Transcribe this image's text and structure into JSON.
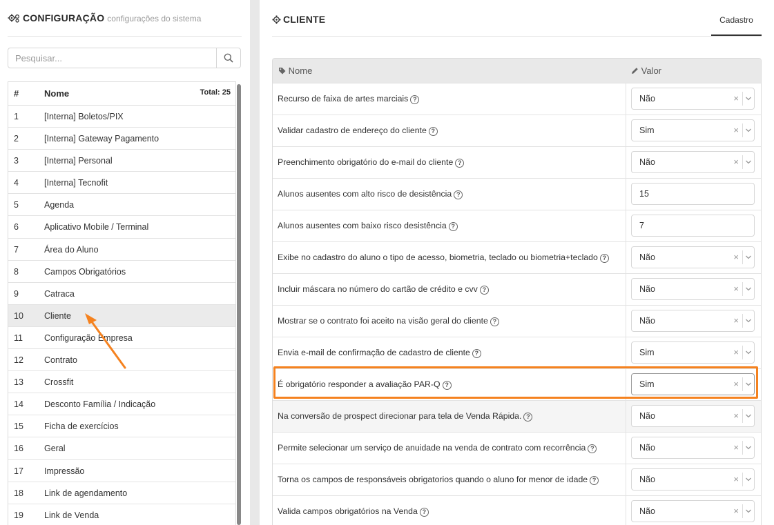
{
  "left_panel": {
    "title": "CONFIGURAÇÃO",
    "subtitle": "configurações do sistema",
    "search_placeholder": "Pesquisar...",
    "list_header": {
      "col_num": "#",
      "col_name": "Nome",
      "total": "Total: 25"
    },
    "items": [
      {
        "num": "1",
        "name": "[Interna] Boletos/PIX"
      },
      {
        "num": "2",
        "name": "[Interna] Gateway Pagamento"
      },
      {
        "num": "3",
        "name": "[Interna] Personal"
      },
      {
        "num": "4",
        "name": "[Interna] Tecnofit"
      },
      {
        "num": "5",
        "name": "Agenda"
      },
      {
        "num": "6",
        "name": "Aplicativo Mobile / Terminal"
      },
      {
        "num": "7",
        "name": "Área do Aluno"
      },
      {
        "num": "8",
        "name": "Campos Obrigatórios"
      },
      {
        "num": "9",
        "name": "Catraca"
      },
      {
        "num": "10",
        "name": "Cliente",
        "selected": true
      },
      {
        "num": "11",
        "name": "Configuração Empresa"
      },
      {
        "num": "12",
        "name": "Contrato"
      },
      {
        "num": "13",
        "name": "Crossfit"
      },
      {
        "num": "14",
        "name": "Desconto Família / Indicação"
      },
      {
        "num": "15",
        "name": "Ficha de exercícios"
      },
      {
        "num": "16",
        "name": "Geral"
      },
      {
        "num": "17",
        "name": "Impressão"
      },
      {
        "num": "18",
        "name": "Link de agendamento"
      },
      {
        "num": "19",
        "name": "Link de Venda"
      }
    ]
  },
  "right_panel": {
    "title": "CLIENTE",
    "tab": "Cadastro",
    "table_header": {
      "col_name": "Nome",
      "col_value": "Valor"
    },
    "rows": [
      {
        "label": "Recurso de faixa de artes marciais",
        "type": "select",
        "value": "Não"
      },
      {
        "label": "Validar cadastro de endereço do cliente",
        "type": "select",
        "value": "Sim"
      },
      {
        "label": "Preenchimento obrigatório do e-mail do cliente",
        "type": "select",
        "value": "Não"
      },
      {
        "label": "Alunos ausentes com alto risco de desistência",
        "type": "number",
        "value": "15"
      },
      {
        "label": "Alunos ausentes com baixo risco desistência",
        "type": "number",
        "value": "7"
      },
      {
        "label": "Exibe no cadastro do aluno o tipo de acesso, biometria, teclado ou biometria+teclado",
        "type": "select",
        "value": "Não"
      },
      {
        "label": "Incluir máscara no número do cartão de crédito e cvv",
        "type": "select",
        "value": "Não"
      },
      {
        "label": "Mostrar se o contrato foi aceito na visão geral do cliente",
        "type": "select",
        "value": "Não"
      },
      {
        "label": "Envia e-mail de confirmação de cadastro de cliente",
        "type": "select",
        "value": "Sim"
      },
      {
        "label": "É obrigatório responder a avaliação PAR-Q",
        "type": "select",
        "value": "Sim",
        "highlighted": true
      },
      {
        "label": "Na conversão de prospect direcionar para tela de Venda Rápida.",
        "type": "select",
        "value": "Não"
      },
      {
        "label": "Permite selecionar um serviço de anuidade na venda de contrato com recorrência",
        "type": "select",
        "value": "Não"
      },
      {
        "label": "Torna os campos de responsáveis obrigatorios quando o aluno for menor de idade",
        "type": "select",
        "value": "Não"
      },
      {
        "label": "Valida campos obrigatórios na Venda",
        "type": "select",
        "value": "Não"
      }
    ]
  },
  "colors": {
    "highlight": "#f5821f",
    "selected_row": "#ebebeb",
    "header_bg": "#e9e9e9"
  },
  "icons": [
    "gears-icon",
    "search-icon",
    "tag-icon",
    "pencil-icon",
    "help-icon",
    "clear-icon",
    "chevron-down-icon",
    "arrow-annotation"
  ]
}
